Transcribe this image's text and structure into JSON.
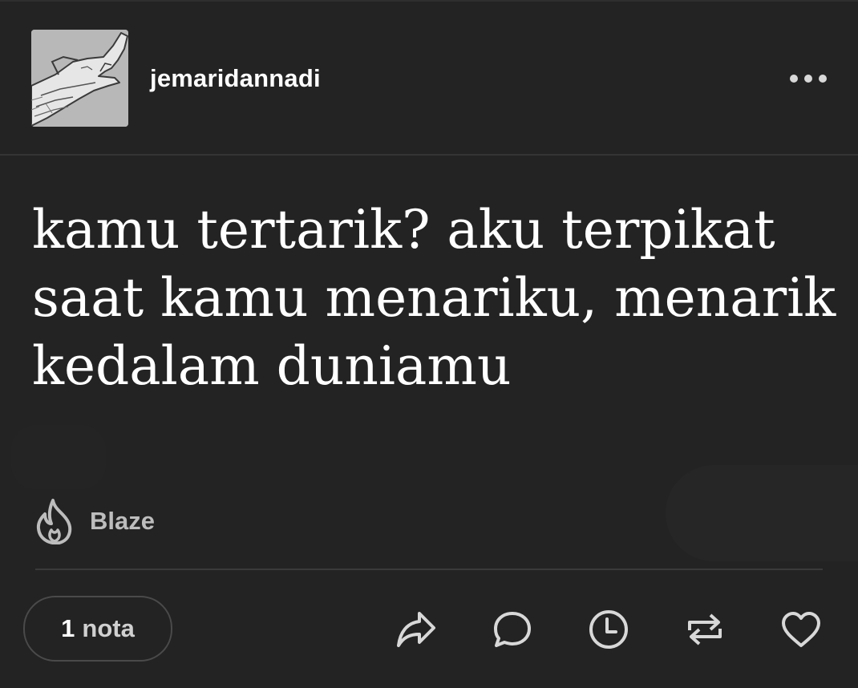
{
  "post": {
    "username": "jemaridannadi",
    "text_lines": [
      "kamu tertarik? aku terpikat",
      "saat kamu menariku, menarik",
      "kedalam duniamu"
    ],
    "blaze_label": "Blaze",
    "notes": {
      "count": "1",
      "label": "nota"
    }
  },
  "icons": {
    "more": "more-horizontal-icon",
    "blaze": "flame-icon",
    "share": "share-icon",
    "reply": "comment-icon",
    "queue": "clock-icon",
    "reblog": "reblog-icon",
    "like": "heart-icon"
  },
  "colors": {
    "background": "#232323",
    "text": "#ffffff",
    "icon": "#d8d8d8",
    "muted_text": "#bdbdbd"
  }
}
